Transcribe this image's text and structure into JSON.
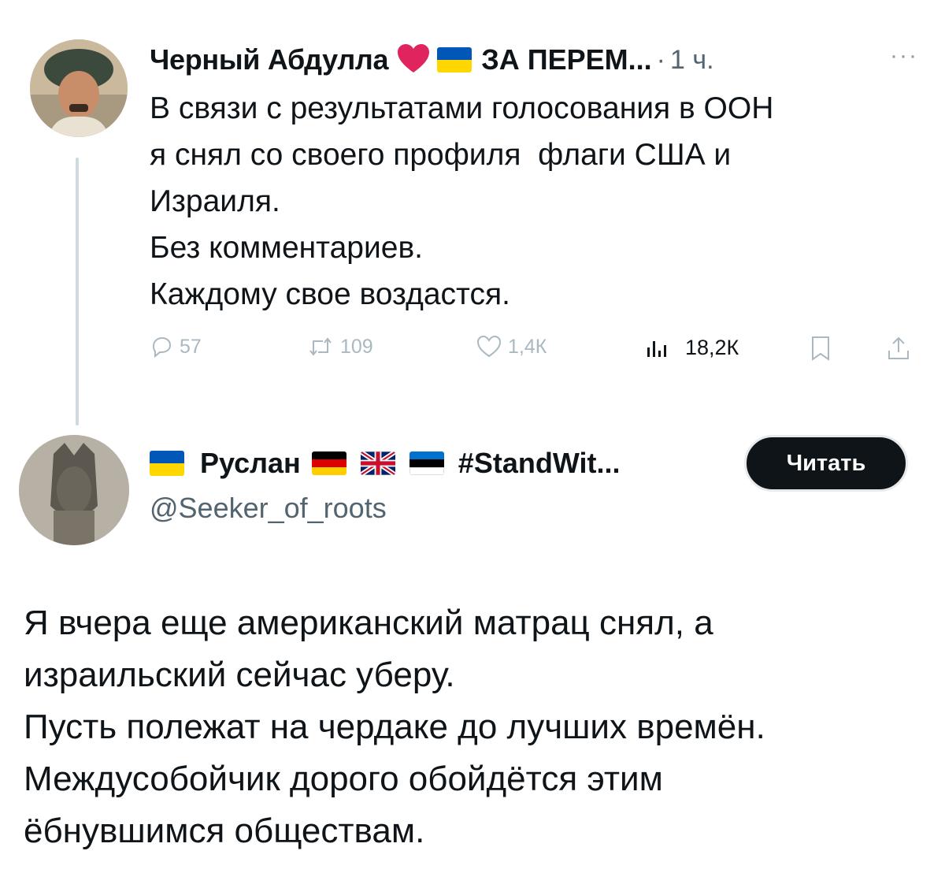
{
  "tweet1": {
    "author_name": "Черный Абдулла",
    "name_suffix": "ЗА ПЕРЕМ...",
    "separator": "·",
    "time": "1 ч.",
    "more_label": "···",
    "text_lines": [
      "В связи с результатами голосования в ООН",
      "я снял со своего профиля  флаги США и",
      "Израиля.",
      "Без комментариев.",
      "Каждому свое воздастся."
    ],
    "actions": {
      "replies": "57",
      "retweets": "109",
      "likes": "1,4К",
      "views": "18,2К"
    }
  },
  "tweet2": {
    "author_name": "Руслан",
    "name_tag": "#StandWit...",
    "handle": "@Seeker_of_roots",
    "follow_label": "Читать",
    "text_lines": [
      "Я вчера еще американский матрац снял, а",
      "израильский сейчас уберу.",
      "Пусть полежат на чердаке до лучших времён.",
      "Междусобойчик дорого обойдётся этим",
      "ёбнувшимся обществам."
    ]
  },
  "colors": {
    "text": "#0f1419",
    "secondary": "#536471",
    "muted_icon": "#aab8c2",
    "heart": "#e0245e",
    "ukraine_blue": "#0057b7",
    "ukraine_yellow": "#ffd700",
    "button_bg": "#0f1419"
  },
  "icons": [
    "avatar",
    "red-heart-icon",
    "ukraine-flag-icon",
    "more-icon",
    "reply-icon",
    "retweet-icon",
    "like-icon",
    "views-icon",
    "bookmark-icon",
    "share-icon",
    "germany-flag-icon",
    "uk-flag-icon",
    "estonia-flag-icon"
  ]
}
